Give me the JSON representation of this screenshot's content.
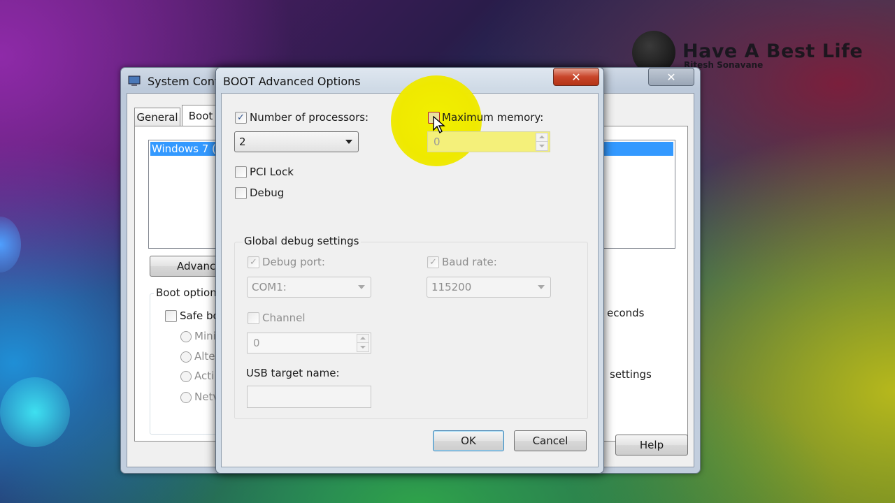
{
  "watermark": {
    "title": "Have A Best Life",
    "subtitle": "Ritesh Sonavane"
  },
  "system_config": {
    "title": "System Conf",
    "close_glyph": "✕",
    "tabs": [
      "General",
      "Boot"
    ],
    "os_list_item": "Windows 7 (C",
    "advanced_button": "Advanced",
    "boot_options_label": "Boot options",
    "safe_boot_label": "Safe bo",
    "radio_labels": [
      "Mini",
      "Alte",
      "Acti",
      "Netv"
    ],
    "seconds_label": "econds",
    "settings_label": "settings",
    "help_button": "Help"
  },
  "boot_dialog": {
    "title": "BOOT Advanced Options",
    "close_glyph": "✕",
    "num_processors": {
      "label": "Number of processors:",
      "checked": true,
      "value": "2"
    },
    "max_memory": {
      "label": "Maximum memory:",
      "checked": false,
      "value": "0"
    },
    "pci_lock": {
      "label": "PCI Lock",
      "checked": false
    },
    "debug": {
      "label": "Debug",
      "checked": false
    },
    "global_debug": {
      "label": "Global debug settings",
      "debug_port": {
        "label": "Debug port:",
        "checked": true,
        "value": "COM1:"
      },
      "baud_rate": {
        "label": "Baud rate:",
        "checked": true,
        "value": "115200"
      },
      "channel": {
        "label": "Channel",
        "checked": false,
        "value": "0"
      },
      "usb_target_label": "USB target name:",
      "usb_target_value": ""
    },
    "ok_button": "OK",
    "cancel_button": "Cancel",
    "check_glyph": "✓"
  },
  "colors": {
    "selection": "#3399ff",
    "close_red": "#c8452a",
    "highlight": "#efe900"
  }
}
